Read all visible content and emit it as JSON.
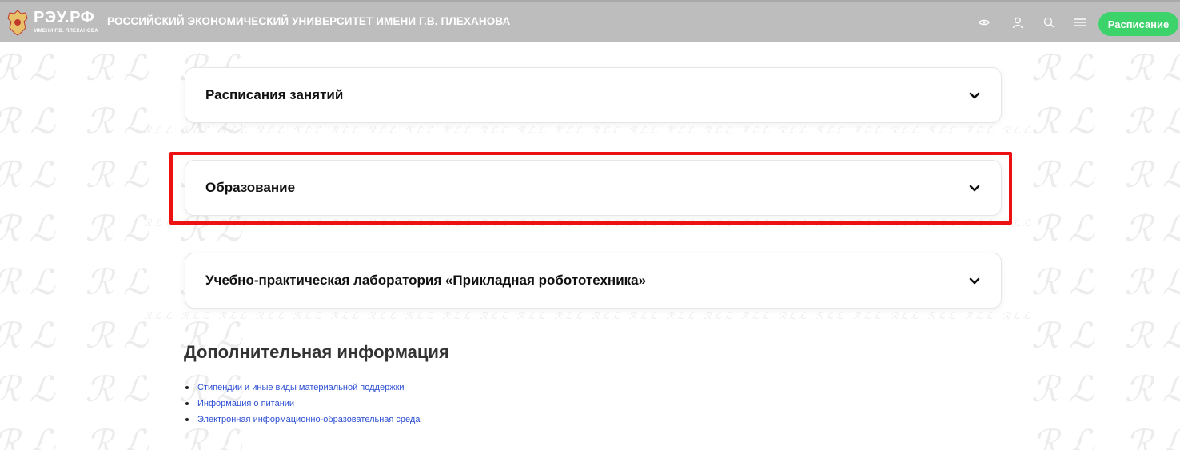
{
  "header": {
    "logo_text": "РЭУ.РФ",
    "logo_subtitle": "ИМЕНИ Г.В. ПЛЕХАНОВА",
    "site_title": "РОССИЙСКИЙ ЭКОНОМИЧЕСКИЙ УНИВЕРСИТЕТ ИМЕНИ Г.В. ПЛЕХАНОВА",
    "schedule_button": "Расписание",
    "icons": [
      "eye-icon",
      "user-icon",
      "search-icon",
      "menu-icon"
    ],
    "accent_color": "#3bd36a",
    "background_color": "#bdbdbd"
  },
  "accordions": [
    {
      "title": "Расписания занятий",
      "expanded": false
    },
    {
      "title": "Образование",
      "expanded": false,
      "highlighted": true
    },
    {
      "title": "Учебно-практическая лаборатория «Прикладная робототехника»",
      "expanded": false
    }
  ],
  "additional_info": {
    "heading": "Дополнительная информация",
    "links": [
      "Стипендии и иные виды материальной поддержки",
      "Информация о питании",
      "Электронная информационно-образовательная среда"
    ]
  },
  "highlight_color": "#ee1111"
}
